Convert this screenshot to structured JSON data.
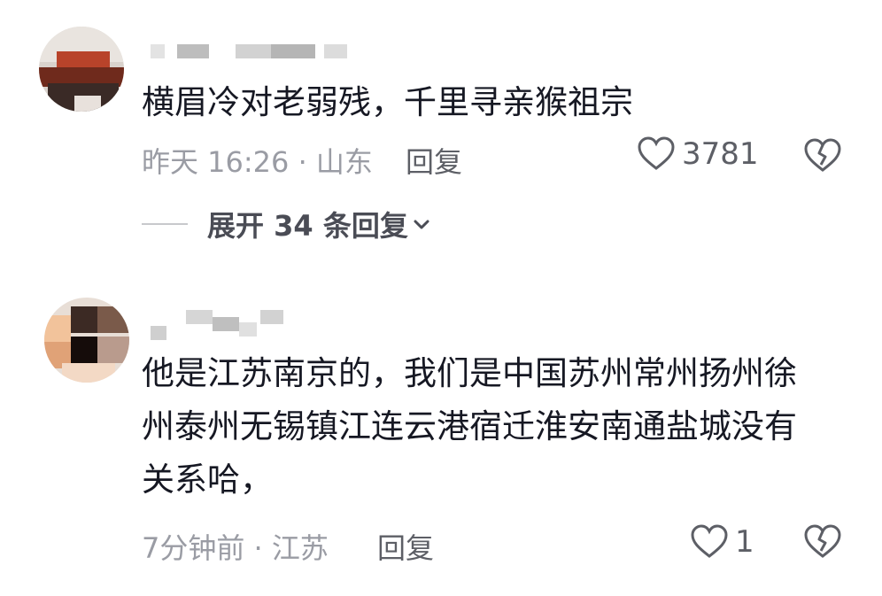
{
  "comments": [
    {
      "text_lines": [
        "横眉冷对老弱残，千里寻亲猴祖宗"
      ],
      "time_location": "昨天 16:26 · 山东",
      "reply_label": "回复",
      "likes": "3781",
      "expand_label": "展开 34 条回复"
    },
    {
      "text_lines": [
        "他是江苏南京的，我们是中国苏州常州扬州徐",
        "州泰州无锡镇江连云港宿迁淮安南通盐城没有",
        "关系哈，"
      ],
      "time_location": "7分钟前 · 江苏",
      "reply_label": "回复",
      "likes": "1"
    }
  ],
  "icons": {
    "like": "heart-outline-icon",
    "dislike": "broken-heart-icon",
    "expand": "chevron-down-icon"
  },
  "colors": {
    "text": "#161823",
    "meta": "#9a9ca4",
    "action": "#5d5f66"
  }
}
